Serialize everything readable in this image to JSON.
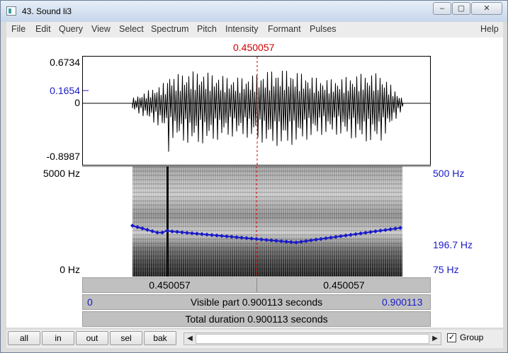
{
  "window": {
    "title": "43. Sound li3",
    "buttons": {
      "minimize": "–",
      "maximize": "▢",
      "close": "✕"
    }
  },
  "menu": {
    "items": [
      "File",
      "Edit",
      "Query",
      "View",
      "Select",
      "Spectrum",
      "Pitch",
      "Intensity",
      "Formant",
      "Pulses"
    ],
    "help": "Help"
  },
  "editor": {
    "cursor_time": "0.450057",
    "waveform": {
      "max_label": "0.6734",
      "cursor_value": "0.1654",
      "zero_label": "0",
      "min_label": "-0.8987"
    },
    "spectrogram": {
      "top_label": "5000 Hz",
      "bottom_label": "0 Hz",
      "pitch_top": "500 Hz",
      "pitch_value": "196.7 Hz",
      "pitch_bottom": "75 Hz"
    },
    "time_bar": {
      "left": "0.450057",
      "right": "0.450057"
    },
    "visible": {
      "start": "0",
      "text": "Visible part 0.900113 seconds",
      "end": "0.900113"
    },
    "total": "Total duration 0.900113 seconds"
  },
  "bottom": {
    "buttons": [
      "all",
      "in",
      "out",
      "sel",
      "bak"
    ],
    "group_label": "Group",
    "group_checked": true,
    "scroll_left": "◀",
    "scroll_right": "▶"
  },
  "colors": {
    "cursor": "#d00000",
    "pitch": "#1a1ac8"
  }
}
